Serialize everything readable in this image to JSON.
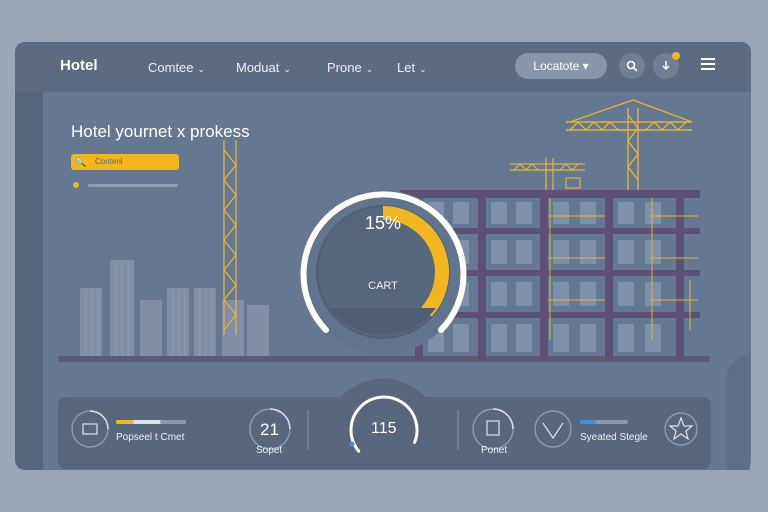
{
  "header": {
    "brand": "Hotel",
    "nav": [
      {
        "label": "Comtee",
        "chevron": "⌄"
      },
      {
        "label": "Moduat",
        "chevron": "⌄"
      },
      {
        "label": "Prone",
        "chevron": "⌄"
      },
      {
        "label": "Let",
        "chevron": "⌄"
      }
    ],
    "locate_label": "Locatote ▾",
    "icons": [
      "search-icon",
      "notification-icon",
      "menu-icon"
    ]
  },
  "hero": {
    "title": "Hotel yournet x prokess",
    "search_placeholder": "Contenl",
    "accent_color": "#f2b71c"
  },
  "gauge": {
    "value_label": "15%",
    "caption": "CART",
    "progress": 0.4
  },
  "bottom": {
    "item1_label": "Popseel t Cmet",
    "item2_value": "21",
    "item2_label": "Sopet",
    "item3_value": "115",
    "item3_progress": 0.7,
    "item4_label": "Ponet",
    "item5_label": "Syeated Stegle"
  }
}
